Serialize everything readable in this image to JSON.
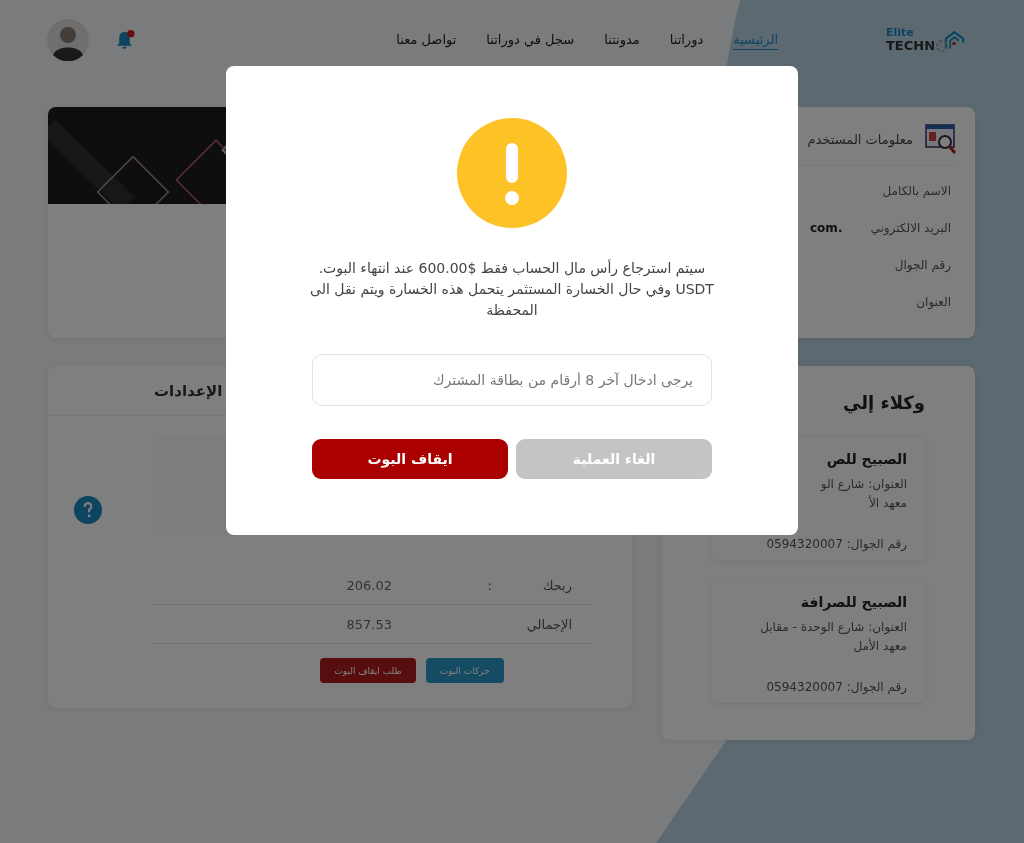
{
  "header": {
    "logo": {
      "top": "Elite",
      "bottom": "TECHN"
    },
    "nav": [
      {
        "label": "الرئيسية",
        "selected": true
      },
      {
        "label": "دوراتنا",
        "selected": false
      },
      {
        "label": "مدونتنا",
        "selected": false
      },
      {
        "label": "سجل في دوراتنا",
        "selected": false
      },
      {
        "label": "تواصل معنا",
        "selected": false
      }
    ],
    "notifications": {
      "unread": true
    }
  },
  "user_info": {
    "title": "معلومات المستخدم",
    "rows": [
      {
        "label": "الاسم بالكامل"
      },
      {
        "label": "البريد الالكتروني",
        "value": ".com"
      },
      {
        "label": "رقم الجوال"
      },
      {
        "label": "العنوان"
      }
    ]
  },
  "agents": {
    "title": "وكلاء إلي",
    "items": [
      {
        "name": "الصبيح للص",
        "address": [
          "العنوان: شارع الو",
          "معهد الأ"
        ],
        "phone": "رقم الجوال: 0594320007"
      },
      {
        "name": "الصبيح للصرافة",
        "address": [
          "العنوان: شارع الوحدة - مقابل",
          "معهد الأمل"
        ],
        "phone": "رقم الجوال: 0594320007"
      }
    ]
  },
  "settings": {
    "tab": "الإعدادات",
    "rows": [
      {
        "label": "ربحك",
        "separator": ":",
        "value": "206.02"
      },
      {
        "label": "الإجمالي",
        "value": "857.53"
      }
    ],
    "buttons": [
      {
        "label": "حركات البوت",
        "kind": "info"
      },
      {
        "label": "طلب ايقاف البوت",
        "kind": "danger"
      }
    ]
  },
  "dialog": {
    "message": "سيتم استرجاع رأس مال الحساب فقط $600.00 عند انتهاء البوت. USDT وفي حال الخسارة المستثمر يتحمل هذه الخسارة ويتم نقل الى المحفظة",
    "input": {
      "placeholder": "يرجى ادخال آخر 8 أرقام من بطاقة المشترك"
    },
    "buttons": [
      {
        "label": "الغاء العملية",
        "kind": "cancel"
      },
      {
        "label": "ايقاف البوت",
        "kind": "confirm"
      }
    ]
  }
}
